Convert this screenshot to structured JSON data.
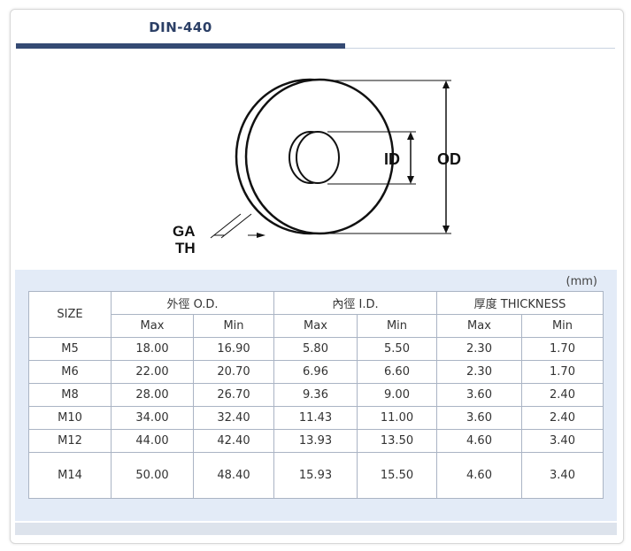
{
  "title": "DIN-440",
  "diagram": {
    "labels": {
      "ga": "GA",
      "th": "TH",
      "id": "ID",
      "od": "OD"
    }
  },
  "table": {
    "unit": "(mm)",
    "size_header": "SIZE",
    "groups": [
      "外徑 O.D.",
      "內徑 I.D.",
      "厚度 THICKNESS"
    ],
    "sub_headers": [
      "Max",
      "Min",
      "Max",
      "Min",
      "Max",
      "Min"
    ],
    "rows": [
      {
        "size": "M5",
        "values": [
          "18.00",
          "16.90",
          "5.80",
          "5.50",
          "2.30",
          "1.70"
        ]
      },
      {
        "size": "M6",
        "values": [
          "22.00",
          "20.70",
          "6.96",
          "6.60",
          "2.30",
          "1.70"
        ]
      },
      {
        "size": "M8",
        "values": [
          "28.00",
          "26.70",
          "9.36",
          "9.00",
          "3.60",
          "2.40"
        ]
      },
      {
        "size": "M10",
        "values": [
          "34.00",
          "32.40",
          "11.43",
          "11.00",
          "3.60",
          "2.40"
        ]
      },
      {
        "size": "M12",
        "values": [
          "44.00",
          "42.40",
          "13.93",
          "13.50",
          "4.60",
          "3.40"
        ]
      },
      {
        "size": "M14",
        "values": [
          "50.00",
          "48.40",
          "15.93",
          "15.50",
          "4.60",
          "3.40"
        ]
      }
    ]
  }
}
